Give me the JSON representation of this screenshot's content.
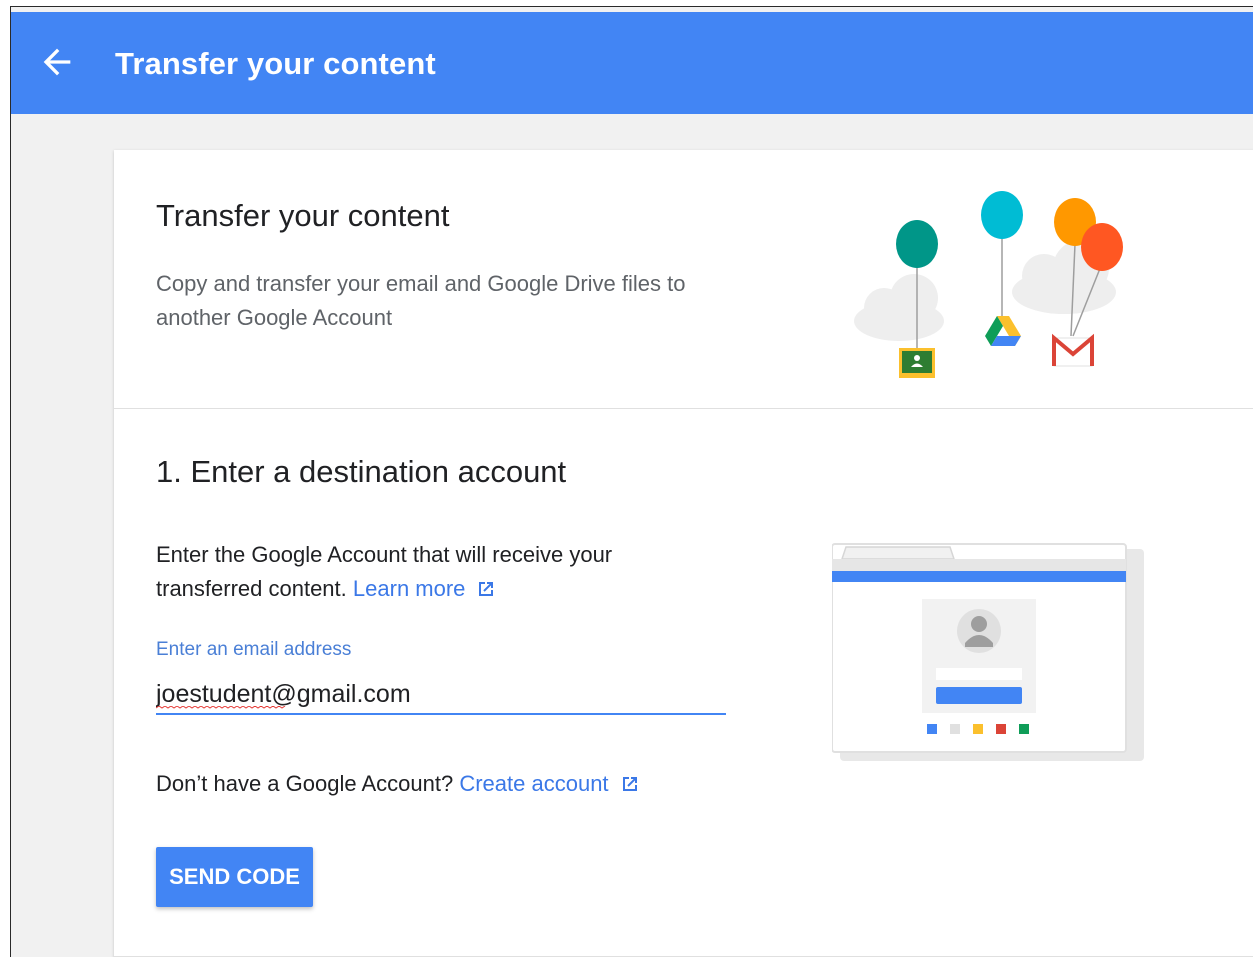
{
  "appbar": {
    "title": "Transfer your content",
    "back_icon": "arrow-back-icon",
    "color": "#4285f4"
  },
  "intro": {
    "title": "Transfer your content",
    "description": "Copy and transfer your email and Google Drive files to another Google Account",
    "illustration_icons": [
      "balloon-icon",
      "cloud-icon",
      "google-classroom-icon",
      "google-drive-icon",
      "gmail-icon"
    ]
  },
  "step1": {
    "title": "1. Enter a destination account",
    "description": "Enter the Google Account that will receive your transferred content.",
    "learn_more_label": "Learn more",
    "email_label": "Enter an email address",
    "email_value": "joestudent@gmail.com",
    "no_account_text": "Don’t have a Google Account?",
    "create_account_label": "Create account",
    "send_code_label": "SEND CODE",
    "external_link_icon": "open-in-new-icon"
  },
  "colors": {
    "accent": "#4285f4",
    "link": "#3b78e7",
    "background": "#f1f1f1"
  }
}
